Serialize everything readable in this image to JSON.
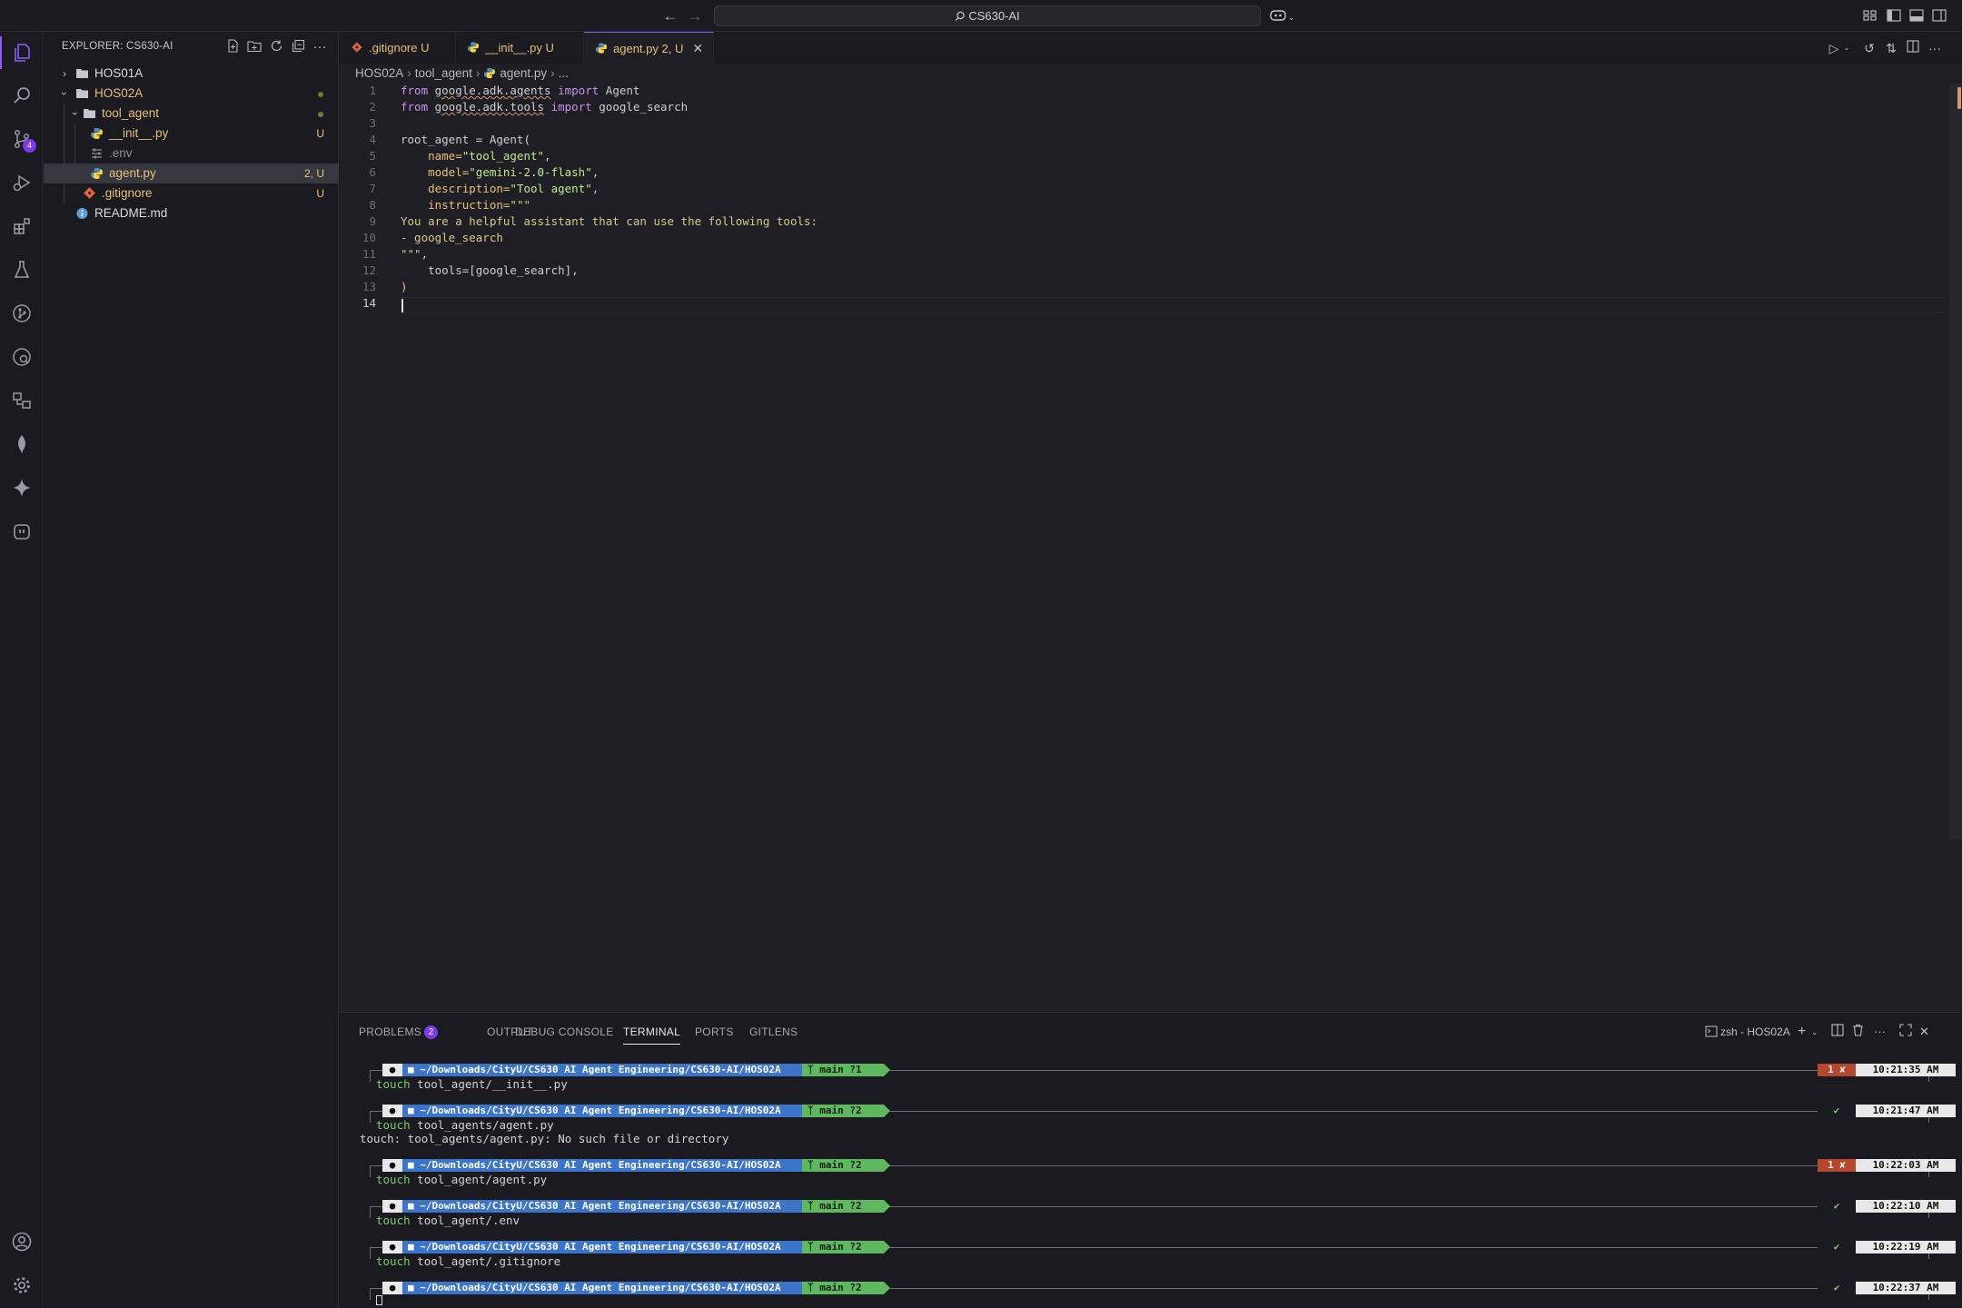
{
  "titlebar": {
    "search_text": "CS630-AI"
  },
  "activity": {
    "scm_badge": "4"
  },
  "explorer": {
    "title": "EXPLORER: CS630-AI",
    "tree": [
      {
        "label": "HOS01A",
        "status": ""
      },
      {
        "label": "HOS02A",
        "status": ""
      },
      {
        "label": "tool_agent",
        "status": ""
      },
      {
        "label": "__init__.py",
        "status": "U"
      },
      {
        "label": ".env",
        "status": ""
      },
      {
        "label": "agent.py",
        "status": "2, U"
      },
      {
        "label": ".gitignore",
        "status": "U"
      },
      {
        "label": "README.md",
        "status": ""
      }
    ]
  },
  "tabs": [
    {
      "label": ".gitignore",
      "status": "U"
    },
    {
      "label": "__init__.py",
      "status": "U"
    },
    {
      "label": "agent.py",
      "status": "2, U"
    }
  ],
  "breadcrumb": {
    "part1": "HOS02A",
    "part2": "tool_agent",
    "part3": "agent.py",
    "part4": "..."
  },
  "editor": {
    "line_numbers": [
      "1",
      "2",
      "3",
      "4",
      "5",
      "6",
      "7",
      "8",
      "9",
      "10",
      "11",
      "12",
      "13",
      "14"
    ],
    "code": {
      "l1_from": "from",
      "l1_mod": "google.adk.agents",
      "l1_import": "import",
      "l1_name": "Agent",
      "l2_from": "from",
      "l2_mod": "google.adk.tools",
      "l2_import": "import",
      "l2_name": "google_search",
      "l4_a": "root_agent = Agent(",
      "l5_k": "    name=",
      "l5_v": "\"tool_agent\"",
      "l5_c": ",",
      "l6_k": "    model=",
      "l6_v": "\"gemini-2.0-flash\"",
      "l6_c": ",",
      "l7_k": "    description=",
      "l7_v": "\"Tool agent\"",
      "l7_c": ",",
      "l8_k": "    instruction=",
      "l8_v": "\"\"\"",
      "l9": "You are a helpful assistant that can use the following tools:",
      "l10": "- google_search",
      "l11": "\"\"\",",
      "l12": "    tools=[google_search],",
      "l13": ")"
    }
  },
  "panel": {
    "tabs": {
      "problems": "PROBLEMS",
      "problems_count": "2",
      "output": "OUTPUT",
      "debug": "DEBUG CONSOLE",
      "terminal": "TERMINAL",
      "ports": "PORTS",
      "gitlens": "GITLENS"
    },
    "terminal_name": "zsh - HOS02A",
    "prompts": [
      {
        "path": "~/Downloads/CityU/CS630 AI Agent Engineering/CS630-AI/HOS02A",
        "git": "main ?1",
        "status": "1 ✘",
        "status_kind": "err",
        "time": "10:21:35 AM",
        "cmd_word": "touch",
        "cmd_rest": " tool_agent/__init__.py",
        "output": ""
      },
      {
        "path": "~/Downloads/CityU/CS630 AI Agent Engineering/CS630-AI/HOS02A",
        "git": "main ?2",
        "status": "✔",
        "status_kind": "ok",
        "time": "10:21:47 AM",
        "cmd_word": "touch",
        "cmd_rest": " tool_agents/agent.py",
        "output": "touch: tool_agents/agent.py: No such file or directory"
      },
      {
        "path": "~/Downloads/CityU/CS630 AI Agent Engineering/CS630-AI/HOS02A",
        "git": "main ?2",
        "status": "1 ✘",
        "status_kind": "err",
        "time": "10:22:03 AM",
        "cmd_word": "touch",
        "cmd_rest": " tool_agent/agent.py",
        "output": ""
      },
      {
        "path": "~/Downloads/CityU/CS630 AI Agent Engineering/CS630-AI/HOS02A",
        "git": "main ?2",
        "status": "✔",
        "status_kind": "ok",
        "time": "10:22:10 AM",
        "cmd_word": "touch",
        "cmd_rest": " tool_agent/.env",
        "output": ""
      },
      {
        "path": "~/Downloads/CityU/CS630 AI Agent Engineering/CS630-AI/HOS02A",
        "git": "main ?2",
        "status": "✔",
        "status_kind": "ok",
        "time": "10:22:19 AM",
        "cmd_word": "touch",
        "cmd_rest": " tool_agent/.gitignore",
        "output": ""
      },
      {
        "path": "~/Downloads/CityU/CS630 AI Agent Engineering/CS630-AI/HOS02A",
        "git": "main ?2",
        "status": "✔",
        "status_kind": "ok",
        "time": "10:22:37 AM",
        "cmd_word": "",
        "cmd_rest": "",
        "output": ""
      }
    ]
  },
  "colors": {
    "accent": "#8b5cf6",
    "untracked": "#e5c07b",
    "path_segment": "#3b74c9",
    "git_segment": "#5fb85f",
    "error_segment": "#b3482f"
  }
}
